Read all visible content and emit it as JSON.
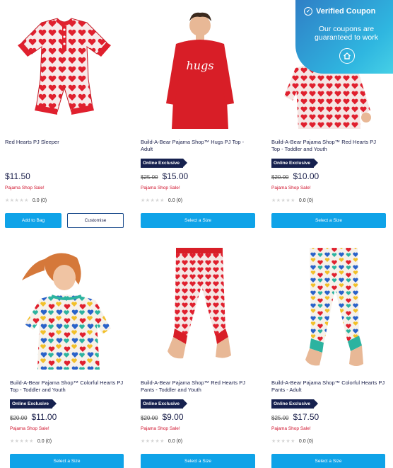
{
  "coupon": {
    "title": "Verified Coupon",
    "subtitle": "Our coupons are guaranteed to work"
  },
  "products": [
    {
      "name": "Red Hearts PJ Sleeper",
      "badge": "",
      "was_price": "",
      "price": "$11.50",
      "promo": "Pajama Shop Sale!",
      "rating_text": "0.0 (0)",
      "rating_value": 0,
      "buttons": [
        "Add to Bag",
        "Customise"
      ]
    },
    {
      "name": "Build-A-Bear Pajama Shop™ Hugs PJ Top - Adult",
      "badge": "Online Exclusive",
      "was_price": "$25.00",
      "price": "$15.00",
      "promo": "Pajama Shop Sale!",
      "rating_text": "0.0 (0)",
      "rating_value": 0,
      "image_text": "hugs",
      "buttons": [
        "Select a Size"
      ]
    },
    {
      "name": "Build-A-Bear Pajama Shop™ Red Hearts PJ Top - Toddler and Youth",
      "badge": "Online Exclusive",
      "was_price": "$20.00",
      "price": "$10.00",
      "promo": "Pajama Shop Sale!",
      "rating_text": "0.0 (0)",
      "rating_value": 0,
      "buttons": [
        "Select a Size"
      ]
    },
    {
      "name": "Build-A-Bear Pajama Shop™ Colorful Hearts PJ Top - Toddler and Youth",
      "badge": "Online Exclusive",
      "was_price": "$20.00",
      "price": "$11.00",
      "promo": "Pajama Shop Sale!",
      "rating_text": "0.0 (0)",
      "rating_value": 0,
      "buttons": [
        "Select a Size"
      ]
    },
    {
      "name": "Build-A-Bear Pajama Shop™ Red Hearts PJ Pants - Toddler and Youth",
      "badge": "Online Exclusive",
      "was_price": "$20.00",
      "price": "$9.00",
      "promo": "Pajama Shop Sale!",
      "rating_text": "0.0 (0)",
      "rating_value": 0,
      "buttons": [
        "Select a Size"
      ]
    },
    {
      "name": "Build-A-Bear Pajama Shop™ Colorful Hearts PJ Pants - Adult",
      "badge": "Online Exclusive",
      "was_price": "$25.00",
      "price": "$17.50",
      "promo": "Pajama Shop Sale!",
      "rating_text": "0.0 (0)",
      "rating_value": 0,
      "buttons": [
        "Select a Size"
      ]
    }
  ],
  "colors": {
    "navy": "#1a1f4a",
    "button_blue": "#0fa3e8",
    "sale_red": "#d0112b",
    "badge_navy": "#16214f",
    "heart_red": "#e0202e"
  }
}
